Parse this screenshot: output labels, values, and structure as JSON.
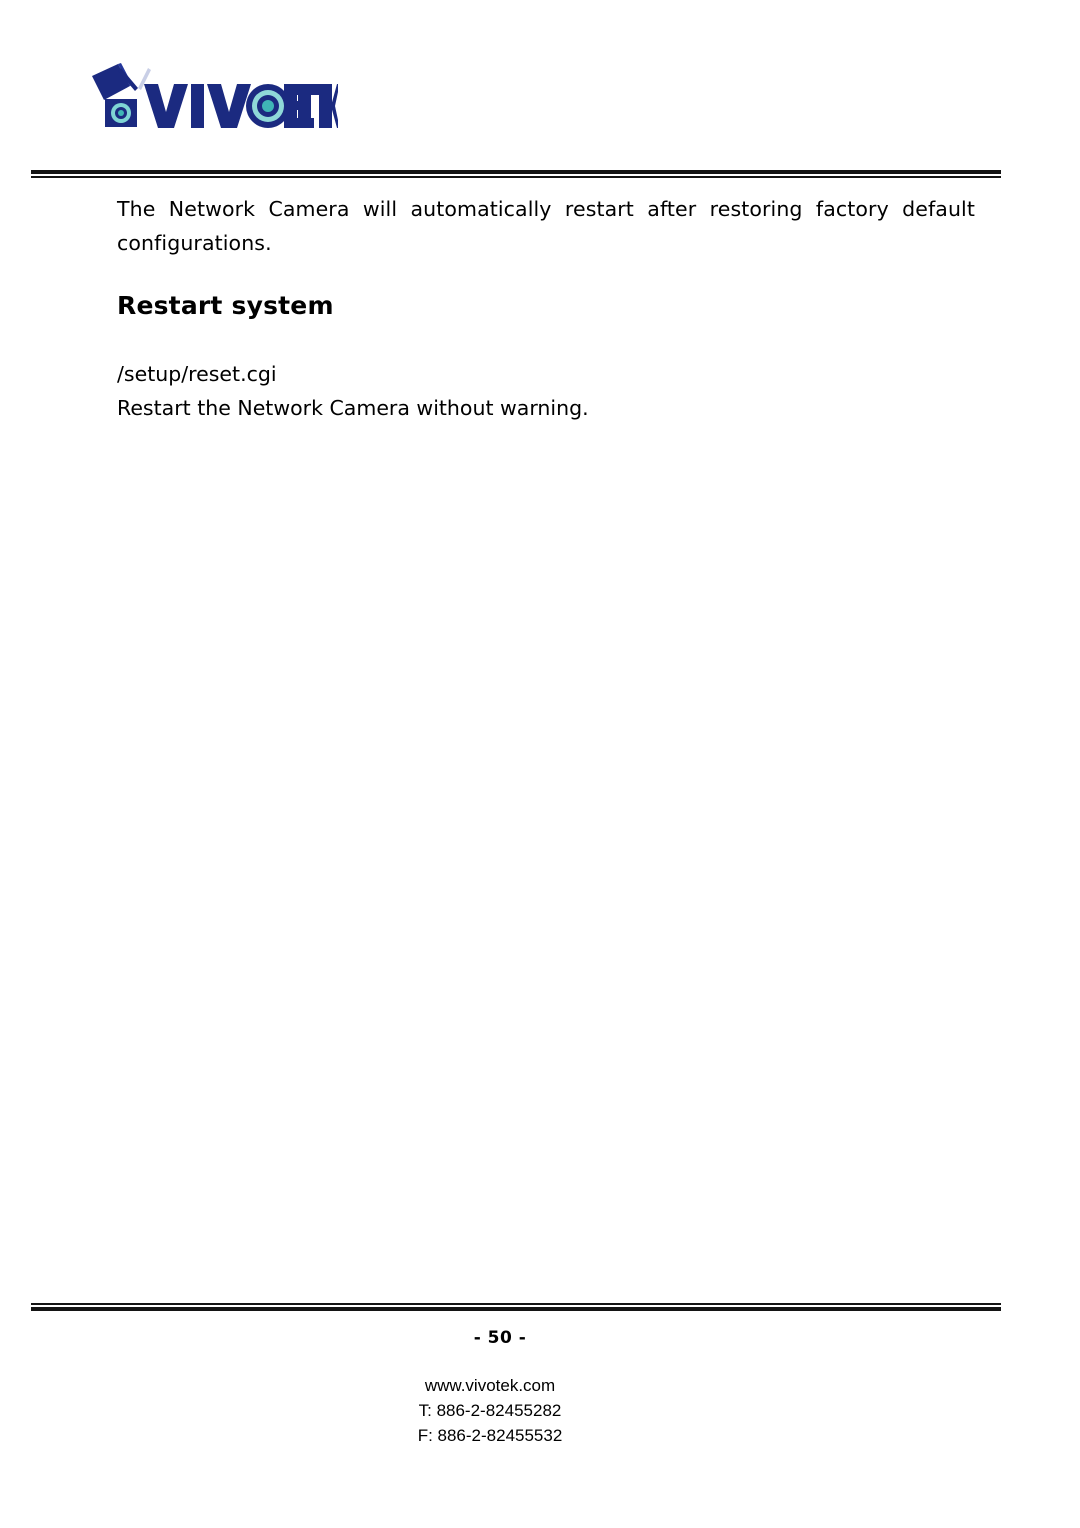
{
  "header": {
    "logo": {
      "name": "vivotek-logo",
      "wordmark": "VIVOTEK",
      "icon_name": "network-camera-icon",
      "brand_color": "#1b2a80",
      "lens_color": "#3fb6b6"
    }
  },
  "content": {
    "intro_paragraph": "The Network Camera will automatically restart after restoring factory default configurations.",
    "section_heading": "Restart system",
    "cgi_path": "/setup/reset.cgi",
    "cgi_description": "Restart the Network Camera without warning."
  },
  "footer": {
    "page_number": "- 50 -",
    "website": "www.vivotek.com",
    "telephone": "T: 886-2-82455282",
    "fax": "F: 886-2-82455532"
  }
}
